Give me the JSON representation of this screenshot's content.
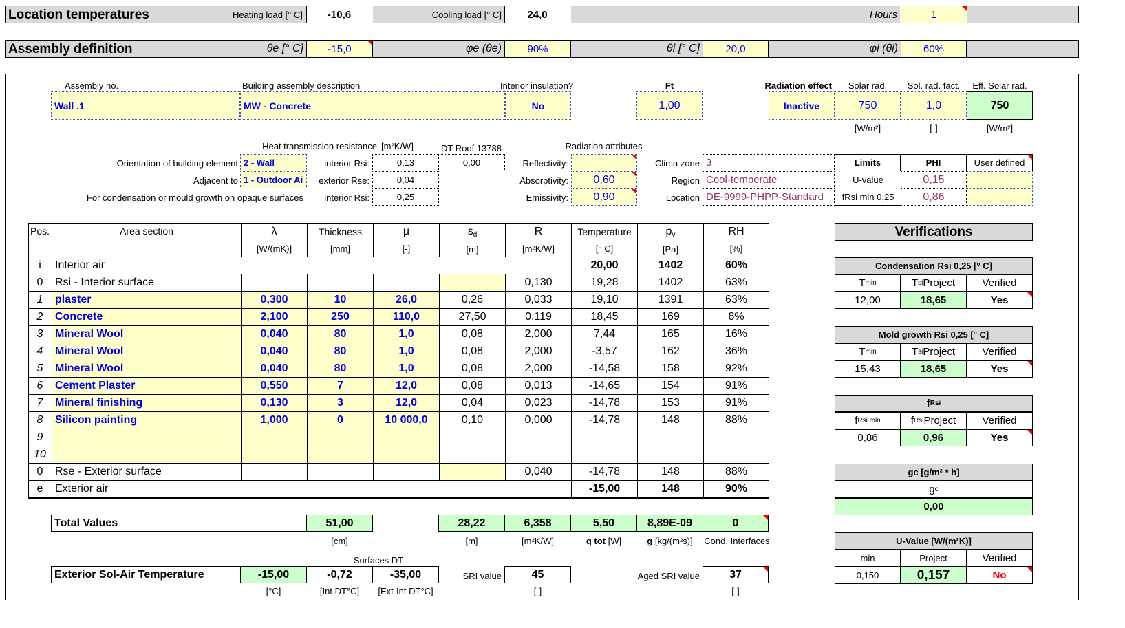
{
  "header": {
    "location_title": "Location temperatures",
    "heating_load_label": "Heating load [° C]",
    "heating_load": "-10,6",
    "cooling_load_label": "Cooling load [° C]",
    "cooling_load": "24,0",
    "hours_label": "Hours",
    "hours": "1",
    "assembly_title": "Assembly definition",
    "theta_e_label": "θe [° C]",
    "theta_e": "-15,0",
    "phi_e_label": "φe (θe)",
    "phi_e": "90%",
    "theta_i_label": "θi [° C]",
    "theta_i": "20,0",
    "phi_i_label": "φi (θi)",
    "phi_i": "60%"
  },
  "assembly": {
    "no_label": "Assembly no.",
    "no": "Wall .1",
    "desc_label": "Building assembly description",
    "desc": "MW - Concrete",
    "interior_insulation_label": "Interior insulation?",
    "interior_insulation": "No",
    "ft_label": "Ft",
    "ft": "1,00",
    "radiation_effect_label": "Radiation effect",
    "radiation_effect": "Inactive",
    "solar_rad_label": "Solar rad.",
    "solar_rad": "750",
    "solar_rad_unit": "[W/m²]",
    "sol_rad_fact_label": "Sol. rad. fact.",
    "sol_rad_fact": "1,0",
    "sol_rad_fact_unit": "[-]",
    "eff_solar_rad_label": "Eff. Solar rad.",
    "eff_solar_rad": "750",
    "eff_solar_rad_unit": "[W/m²]"
  },
  "resistance": {
    "title": "Heat transmission resistance",
    "unit": "[m²K/W]",
    "dt_roof": "DT Roof 13788",
    "orientation_label": "Orientation of building element",
    "orientation": "2 - Wall",
    "adjacent_label": "Adjacent to",
    "adjacent": "1 - Outdoor Ai",
    "condensation_label": "For condensation or mould growth on opaque surfaces",
    "rsi_label": "interior Rsi:",
    "rsi": "0,13",
    "rsi_dt": "0,00",
    "rse_label": "exterior Rse:",
    "rse": "0,04",
    "rsi2_label": "interior Rsi:",
    "rsi2": "0,25"
  },
  "radiation": {
    "title": "Radiation attributes",
    "reflectivity_label": "Reflectivity:",
    "reflectivity": "",
    "absorptivity_label": "Absorptivity:",
    "absorptivity": "0,60",
    "emissivity_label": "Emissivity:",
    "emissivity": "0,90"
  },
  "clima": {
    "zone_label": "Clima zone",
    "zone": "3",
    "region_label": "Region",
    "region": "Cool-temperate",
    "location_label": "Location",
    "location": "DE-9999-PHPP-Standard",
    "limits_label": "Limits",
    "phi_label": "PHI",
    "user_defined_label": "User defined",
    "uvalue_label": "U-value",
    "uvalue": "0,15",
    "frsi_label": "fRsi min 0,25",
    "frsi": "0,86"
  },
  "table": {
    "headers": {
      "pos": "Pos.",
      "area": "Area section",
      "lambda": "λ",
      "lambda_unit": "[W/(mK)]",
      "thickness": "Thickness",
      "thickness_unit": "[mm]",
      "mu": "μ",
      "mu_unit": "[-]",
      "sd": "s",
      "sd_sub": "d",
      "sd_unit": "[m]",
      "r": "R",
      "r_unit": "[m²K/W]",
      "temp": "Temperature",
      "temp_unit": "[° C]",
      "pv": "p",
      "pv_sub": "v",
      "pv_unit": "[Pa]",
      "rh": "RH",
      "rh_unit": "[%]"
    },
    "rows": [
      {
        "pos": "i",
        "name": "Interior air",
        "lambda": "",
        "thick": "",
        "mu": "",
        "sd": "",
        "r": "",
        "temp": "20,00",
        "pv": "1402",
        "rh": "60%"
      },
      {
        "pos": "0",
        "name": "Rsi - Interior surface",
        "lambda": "",
        "thick": "",
        "mu": "",
        "sd": "",
        "r": "0,130",
        "temp": "19,28",
        "pv": "1402",
        "rh": "63%"
      },
      {
        "pos": "1",
        "name": "plaster",
        "lambda": "0,300",
        "thick": "10",
        "mu": "26,0",
        "sd": "0,26",
        "r": "0,033",
        "temp": "19,10",
        "pv": "1391",
        "rh": "63%"
      },
      {
        "pos": "2",
        "name": "Concrete",
        "lambda": "2,100",
        "thick": "250",
        "mu": "110,0",
        "sd": "27,50",
        "r": "0,119",
        "temp": "18,45",
        "pv": "169",
        "rh": "8%"
      },
      {
        "pos": "3",
        "name": "Mineral Wool",
        "lambda": "0,040",
        "thick": "80",
        "mu": "1,0",
        "sd": "0,08",
        "r": "2,000",
        "temp": "7,44",
        "pv": "165",
        "rh": "16%"
      },
      {
        "pos": "4",
        "name": "Mineral Wool",
        "lambda": "0,040",
        "thick": "80",
        "mu": "1,0",
        "sd": "0,08",
        "r": "2,000",
        "temp": "-3,57",
        "pv": "162",
        "rh": "36%"
      },
      {
        "pos": "5",
        "name": "Mineral Wool",
        "lambda": "0,040",
        "thick": "80",
        "mu": "1,0",
        "sd": "0,08",
        "r": "2,000",
        "temp": "-14,58",
        "pv": "158",
        "rh": "92%"
      },
      {
        "pos": "6",
        "name": "Cement Plaster",
        "lambda": "0,550",
        "thick": "7",
        "mu": "12,0",
        "sd": "0,08",
        "r": "0,013",
        "temp": "-14,65",
        "pv": "154",
        "rh": "91%"
      },
      {
        "pos": "7",
        "name": "Mineral finishing",
        "lambda": "0,130",
        "thick": "3",
        "mu": "12,0",
        "sd": "0,04",
        "r": "0,023",
        "temp": "-14,78",
        "pv": "153",
        "rh": "91%"
      },
      {
        "pos": "8",
        "name": "Silicon painting",
        "lambda": "1,000",
        "thick": "0",
        "mu": "10 000,0",
        "sd": "0,10",
        "r": "0,000",
        "temp": "-14,78",
        "pv": "148",
        "rh": "88%"
      },
      {
        "pos": "9",
        "name": "",
        "lambda": "",
        "thick": "",
        "mu": "",
        "sd": "",
        "r": "",
        "temp": "",
        "pv": "",
        "rh": ""
      },
      {
        "pos": "10",
        "name": "",
        "lambda": "",
        "thick": "",
        "mu": "",
        "sd": "",
        "r": "",
        "temp": "",
        "pv": "",
        "rh": ""
      },
      {
        "pos": "0",
        "name": "Rse - Exterior surface",
        "lambda": "",
        "thick": "",
        "mu": "",
        "sd": "",
        "r": "0,040",
        "temp": "-14,78",
        "pv": "148",
        "rh": "88%"
      },
      {
        "pos": "e",
        "name": "Exterior air",
        "lambda": "",
        "thick": "",
        "mu": "",
        "sd": "",
        "r": "",
        "temp": "-15,00",
        "pv": "148",
        "rh": "90%"
      }
    ]
  },
  "totals": {
    "label": "Total Values",
    "thickness": "51,00",
    "thickness_unit": "[cm]",
    "sd": "28,22",
    "sd_unit": "[m]",
    "r": "6,358",
    "r_unit": "[m²K/W]",
    "q": "5,50",
    "q_label": "q tot",
    "q_unit": "[W]",
    "g": "8,89E-09",
    "g_label": "g",
    "g_unit": "[kg/(m²s)]",
    "cond": "0",
    "cond_label": "Cond. Interfaces"
  },
  "solair": {
    "surfaces_dt_label": "Surfaces DT",
    "label": "Exterior Sol-Air Temperature",
    "temp": "-15,00",
    "temp_unit": "[°C]",
    "int_dt": "-0,72",
    "int_dt_unit": "[Int DT°C]",
    "ext_int_dt": "-35,00",
    "ext_int_dt_unit": "[Ext-Int DT°C]",
    "sri_label": "SRI value",
    "sri": "45",
    "sri_unit": "[-]",
    "aged_sri_label": "Aged SRI value",
    "aged_sri": "37",
    "aged_sri_unit": "[-]"
  },
  "verifications": {
    "title": "Verifications",
    "condensation": {
      "title": "Condensation Rsi 0,25 [° C]",
      "c1": "T",
      "c1_sub": "min",
      "c2": "T",
      "c2_sub": "si",
      "c2_suffix": " Project",
      "c3": "Verified",
      "v1": "12,00",
      "v2": "18,65",
      "v3": "Yes"
    },
    "mold": {
      "title": "Mold growth Rsi 0,25 [° C]",
      "c1": "T",
      "c1_sub": "min",
      "c2": "T",
      "c2_sub": "si",
      "c2_suffix": " Project",
      "c3": "Verified",
      "v1": "15,43",
      "v2": "18,65",
      "v3": "Yes"
    },
    "frsi": {
      "title": "f",
      "title_sub": "Rsi",
      "c1": "f",
      "c1_sub": "Rsi min",
      "c2": "f",
      "c2_sub": "Rsi",
      "c2_suffix": " Project",
      "c3": "Verified",
      "v1": "0,86",
      "v2": "0,96",
      "v3": "Yes"
    },
    "gc": {
      "title": "gc  [g/m² * h]",
      "label": "g",
      "label_sub": "c",
      "value": "0,00"
    },
    "uvalue": {
      "title": "U-Value [W/(m²K)]",
      "c1": "min",
      "c2": "Project",
      "c3": "Verified",
      "v1": "0,150",
      "v2": "0,157",
      "v3": "No"
    }
  }
}
